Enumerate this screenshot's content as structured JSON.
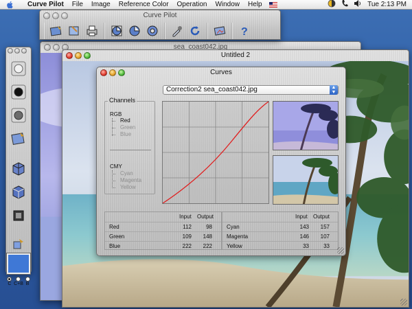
{
  "menubar": {
    "app_name": "Curve Pilot",
    "items": [
      "File",
      "Image",
      "Reference Color",
      "Operation",
      "Window",
      "Help"
    ],
    "clock": "Tue 2:13 PM"
  },
  "windows": {
    "toolbar_title": "Curve Pilot",
    "sea_title": "sea_coast042.jpg",
    "untitled_title": "Untitled 2",
    "curves_title": "Curves"
  },
  "curves": {
    "correction_select": "Correction2  sea_coast042.jpg",
    "channels_legend": "Channels",
    "rgb_label": "RGB",
    "rgb_channels": [
      "Red",
      "Green",
      "Blue"
    ],
    "cmy_label": "CMY",
    "cmy_channels": [
      "Cyan",
      "Magenta",
      "Yellow"
    ],
    "selected_channel": "Red",
    "curve_color": "#e02020",
    "table_header": {
      "input": "Input",
      "output": "Output"
    },
    "rgb_rows": [
      {
        "name": "Red",
        "input": "112",
        "output": "98"
      },
      {
        "name": "Green",
        "input": "109",
        "output": "148"
      },
      {
        "name": "Blue",
        "input": "222",
        "output": "222"
      }
    ],
    "cmy_rows": [
      {
        "name": "Cyan",
        "input": "143",
        "output": "157"
      },
      {
        "name": "Magenta",
        "input": "146",
        "output": "107"
      },
      {
        "name": "Yellow",
        "input": "33",
        "output": "33"
      }
    ]
  },
  "palette": {
    "mode_options": [
      "C",
      "C+B",
      "B"
    ],
    "selected_mode": "C",
    "swatch_color": "#3f78d6"
  }
}
